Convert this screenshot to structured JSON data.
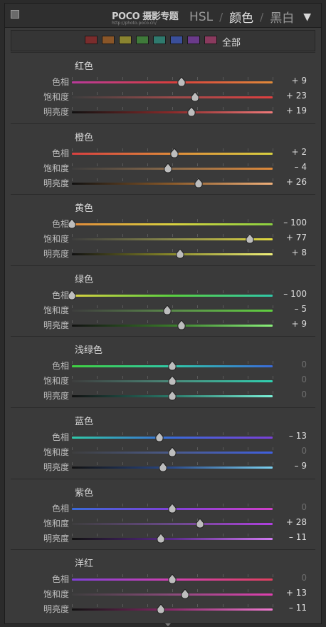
{
  "header": {
    "logo_text": "POCO 摄影专题",
    "logo_sub": "http://photo.poco.cn/",
    "tabs": [
      "HSL",
      "颜色",
      "黑白"
    ],
    "active_tab": 1,
    "menu_icon": "triangle-down-icon"
  },
  "swatchbar": {
    "colors": [
      "#7a2c2c",
      "#8a5628",
      "#8a8430",
      "#3f7a3a",
      "#2f7a6e",
      "#3a4f9a",
      "#6a3a8a",
      "#8a3a5e"
    ],
    "all_label": "全部"
  },
  "row_labels": [
    "色相",
    "饱和度",
    "明亮度"
  ],
  "groups": [
    {
      "title": "红色",
      "rows": [
        {
          "value": 9,
          "text": "+ 9",
          "track": [
            "#b83a9a",
            "#d83e3e",
            "#e08a3a"
          ]
        },
        {
          "value": 23,
          "text": "+ 23",
          "track": [
            "#3e3e3e",
            "#9a4a4a",
            "#e04040"
          ]
        },
        {
          "value": 19,
          "text": "+ 19",
          "track": [
            "#111111",
            "#8a2a2a",
            "#f07a7a"
          ]
        }
      ]
    },
    {
      "title": "橙色",
      "rows": [
        {
          "value": 2,
          "text": "+ 2",
          "track": [
            "#d84040",
            "#e08a3a",
            "#d8d040"
          ]
        },
        {
          "value": -4,
          "text": "– 4",
          "track": [
            "#3e3e3e",
            "#8a6a4a",
            "#e08a3a"
          ]
        },
        {
          "value": 26,
          "text": "+ 26",
          "track": [
            "#111111",
            "#8a5a2a",
            "#f0b07a"
          ]
        }
      ]
    },
    {
      "title": "黄色",
      "rows": [
        {
          "value": -100,
          "text": "– 100",
          "track": [
            "#e08a3a",
            "#d8d040",
            "#8ad040"
          ]
        },
        {
          "value": 77,
          "text": "+ 77",
          "track": [
            "#3e3e3e",
            "#8a8a4a",
            "#e0d840"
          ]
        },
        {
          "value": 8,
          "text": "+ 8",
          "track": [
            "#111111",
            "#8a8a2a",
            "#f0f07a"
          ]
        }
      ]
    },
    {
      "title": "绿色",
      "rows": [
        {
          "value": -100,
          "text": "– 100",
          "track": [
            "#d8d040",
            "#5ad040",
            "#30c8a8"
          ]
        },
        {
          "value": -5,
          "text": "– 5",
          "track": [
            "#3e3e3e",
            "#5a8a4a",
            "#60d040"
          ]
        },
        {
          "value": 9,
          "text": "+ 9",
          "track": [
            "#111111",
            "#3a7a2a",
            "#8af07a"
          ]
        }
      ]
    },
    {
      "title": "浅绿色",
      "rows": [
        {
          "value": 0,
          "text": "0",
          "track": [
            "#40d040",
            "#30c8a8",
            "#3a6ad8"
          ]
        },
        {
          "value": 0,
          "text": "0",
          "track": [
            "#3e3e3e",
            "#4a8a7a",
            "#30d0b0"
          ]
        },
        {
          "value": 0,
          "text": "0",
          "track": [
            "#111111",
            "#2a7a6a",
            "#7af0d8"
          ]
        }
      ]
    },
    {
      "title": "蓝色",
      "rows": [
        {
          "value": -13,
          "text": "– 13",
          "track": [
            "#30c8a8",
            "#3a6ad8",
            "#7a40d8"
          ]
        },
        {
          "value": 0,
          "text": "0",
          "track": [
            "#3e3e3e",
            "#4a5a8a",
            "#4060e0"
          ]
        },
        {
          "value": -9,
          "text": "– 9",
          "track": [
            "#111111",
            "#2a4a8a",
            "#7ad0f0"
          ]
        }
      ]
    },
    {
      "title": "紫色",
      "rows": [
        {
          "value": 0,
          "text": "0",
          "track": [
            "#3a6ad8",
            "#8040d8",
            "#d040c8"
          ]
        },
        {
          "value": 28,
          "text": "+ 28",
          "track": [
            "#3e3e3e",
            "#6a4a8a",
            "#b040e0"
          ]
        },
        {
          "value": -11,
          "text": "– 11",
          "track": [
            "#111111",
            "#5a2a8a",
            "#d07af0"
          ]
        }
      ]
    },
    {
      "title": "洋红",
      "rows": [
        {
          "value": 0,
          "text": "0",
          "track": [
            "#8040d8",
            "#d040b0",
            "#e04060"
          ]
        },
        {
          "value": 13,
          "text": "+ 13",
          "track": [
            "#3e3e3e",
            "#8a4a7a",
            "#e040b0"
          ]
        },
        {
          "value": -11,
          "text": "– 11",
          "track": [
            "#111111",
            "#8a2a6a",
            "#f07ad0"
          ]
        }
      ]
    }
  ]
}
